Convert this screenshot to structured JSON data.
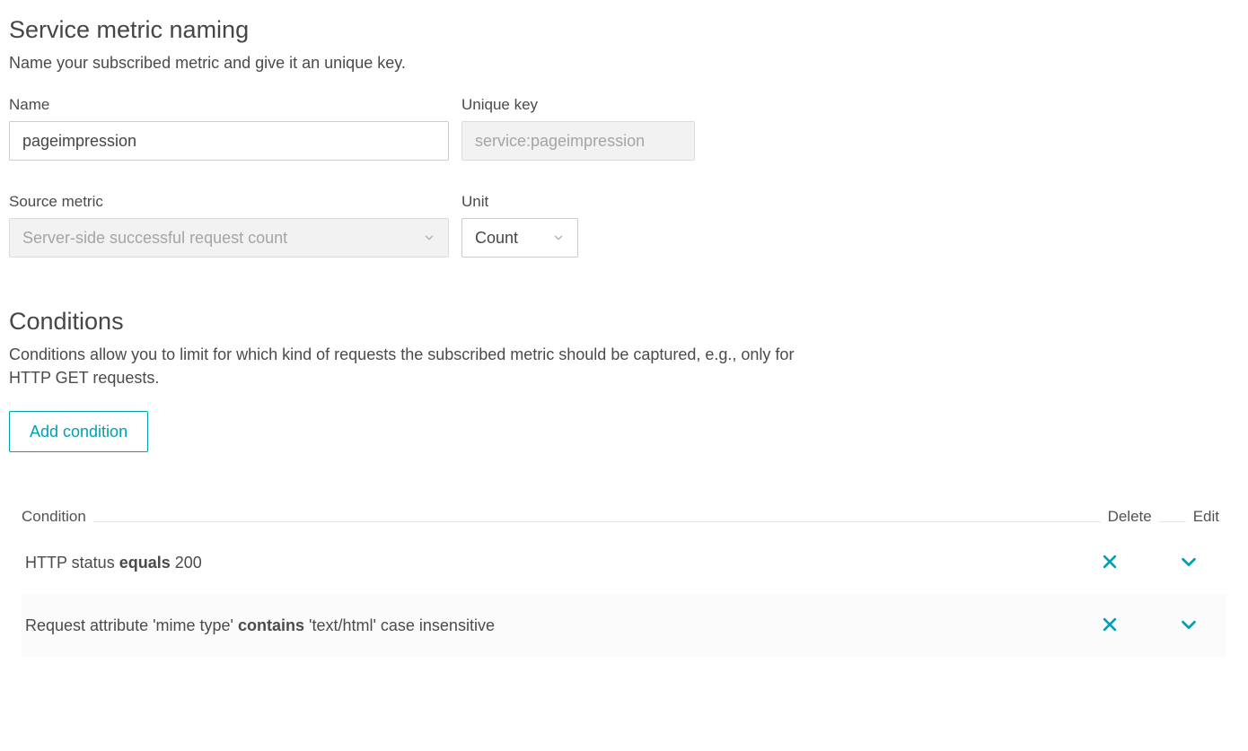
{
  "naming": {
    "title": "Service metric naming",
    "description": "Name your subscribed metric and give it an unique key.",
    "name_label": "Name",
    "name_value": "pageimpression",
    "key_label": "Unique key",
    "key_value": "service:pageimpression",
    "source_metric_label": "Source metric",
    "source_metric_value": "Server-side successful request count",
    "unit_label": "Unit",
    "unit_value": "Count"
  },
  "conditions": {
    "title": "Conditions",
    "description": "Conditions allow you to limit for which kind of requests the subscribed metric should be captured, e.g., only for HTTP GET requests.",
    "add_button_label": "Add condition",
    "table_headers": {
      "condition": "Condition",
      "delete": "Delete",
      "edit": "Edit"
    },
    "rows": [
      {
        "prefix": "HTTP status ",
        "op": "equals",
        "suffix": " 200"
      },
      {
        "prefix": "Request attribute 'mime type' ",
        "op": "contains",
        "suffix": " 'text/html' case insensitive"
      }
    ]
  },
  "colors": {
    "teal": "#00a1b2"
  }
}
